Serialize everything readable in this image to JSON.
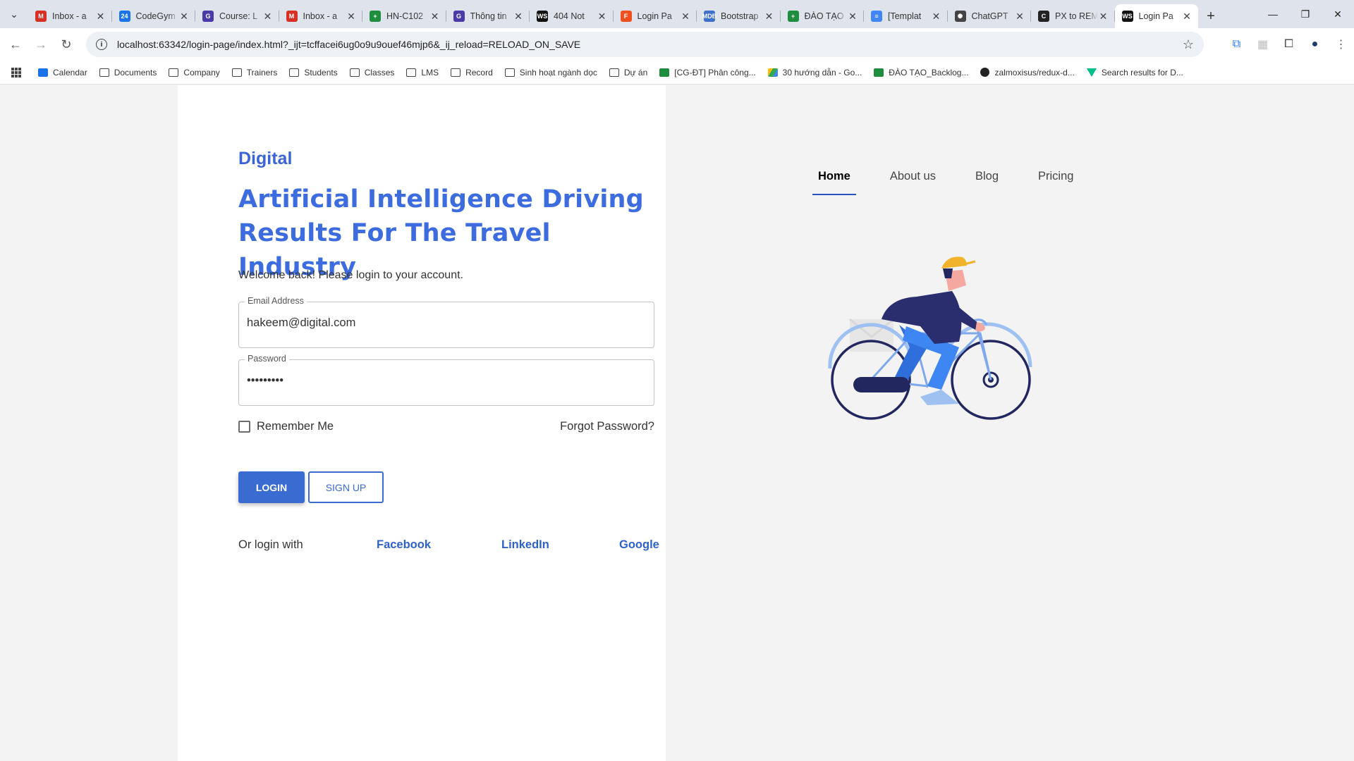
{
  "browser": {
    "tabs": [
      {
        "title": "Inbox - a",
        "icon": "gmail-icon",
        "color": "#d93025",
        "glyph": "M"
      },
      {
        "title": "CodeGym",
        "icon": "calendar-icon",
        "color": "#1a73e8",
        "glyph": "24"
      },
      {
        "title": "Course: L",
        "icon": "codegym-icon",
        "color": "#4a3aa8",
        "glyph": "G"
      },
      {
        "title": "Inbox - a",
        "icon": "gmail-icon",
        "color": "#d93025",
        "glyph": "M"
      },
      {
        "title": "HN-C102",
        "icon": "sheets-icon",
        "color": "#1e8e3e",
        "glyph": "+"
      },
      {
        "title": "Thông tin",
        "icon": "codegym-icon",
        "color": "#4a3aa8",
        "glyph": "G"
      },
      {
        "title": "404 Not",
        "icon": "webstorm-icon",
        "color": "#111111",
        "glyph": "WS"
      },
      {
        "title": "Login Pa",
        "icon": "figma-icon",
        "color": "#f24e1e",
        "glyph": "F"
      },
      {
        "title": "Bootstrap",
        "icon": "mdb-icon",
        "color": "#3b71ca",
        "glyph": "MDB"
      },
      {
        "title": "ĐÀO TẠO",
        "icon": "sheets-icon",
        "color": "#1e8e3e",
        "glyph": "+"
      },
      {
        "title": "[Templat",
        "icon": "docs-icon",
        "color": "#4285f4",
        "glyph": "≡"
      },
      {
        "title": "ChatGPT",
        "icon": "chatgpt-icon",
        "color": "#444444",
        "glyph": "✺"
      },
      {
        "title": "PX to REM",
        "icon": "converter-icon",
        "color": "#222222",
        "glyph": "C"
      },
      {
        "title": "Login Pa",
        "icon": "webstorm-icon",
        "color": "#111111",
        "glyph": "WS"
      }
    ],
    "new_tab": "+",
    "url": "localhost:63342/login-page/index.html?_ijt=tcffacei6ug0o9u9ouef46mjp6&_ij_reload=RELOAD_ON_SAVE",
    "bookmarks": [
      {
        "label": "Calendar",
        "icon": "cal"
      },
      {
        "label": "Documents",
        "icon": "folder"
      },
      {
        "label": "Company",
        "icon": "folder"
      },
      {
        "label": "Trainers",
        "icon": "folder"
      },
      {
        "label": "Students",
        "icon": "folder"
      },
      {
        "label": "Classes",
        "icon": "folder"
      },
      {
        "label": "LMS",
        "icon": "folder"
      },
      {
        "label": "Record",
        "icon": "folder"
      },
      {
        "label": "Sinh hoạt ngành dọc",
        "icon": "folder"
      },
      {
        "label": "Dự án",
        "icon": "folder"
      },
      {
        "label": "[CG-ĐT] Phân công...",
        "icon": "sheet"
      },
      {
        "label": "30 hướng dẫn - Go...",
        "icon": "drive"
      },
      {
        "label": "ĐÀO TẠO_Backlog...",
        "icon": "sheet"
      },
      {
        "label": "zalmoxisus/redux-d...",
        "icon": "gh"
      },
      {
        "label": "Search results for D...",
        "icon": "tri"
      }
    ]
  },
  "login": {
    "brand": "Digital",
    "headline": "Artificial Intelligence Driving Results For The Travel Industry",
    "welcome": "Welcome back! Please login to your account.",
    "email_label": "Email Address",
    "email_value": "hakeem@digital.com",
    "password_label": "Password",
    "password_value": "•••••••••",
    "remember_label": "Remember Me",
    "forgot_label": "Forgot Password?",
    "login_button": "LOGIN",
    "signup_button": "SIGN UP",
    "or_login_with": "Or login with",
    "facebook": "Facebook",
    "linkedin": "LinkedIn",
    "google": "Google"
  },
  "nav": {
    "items": [
      "Home",
      "About us",
      "Blog",
      "Pricing"
    ],
    "active": "Home"
  },
  "colors": {
    "accent": "#3a6bd0",
    "headline": "#3c6cde"
  }
}
